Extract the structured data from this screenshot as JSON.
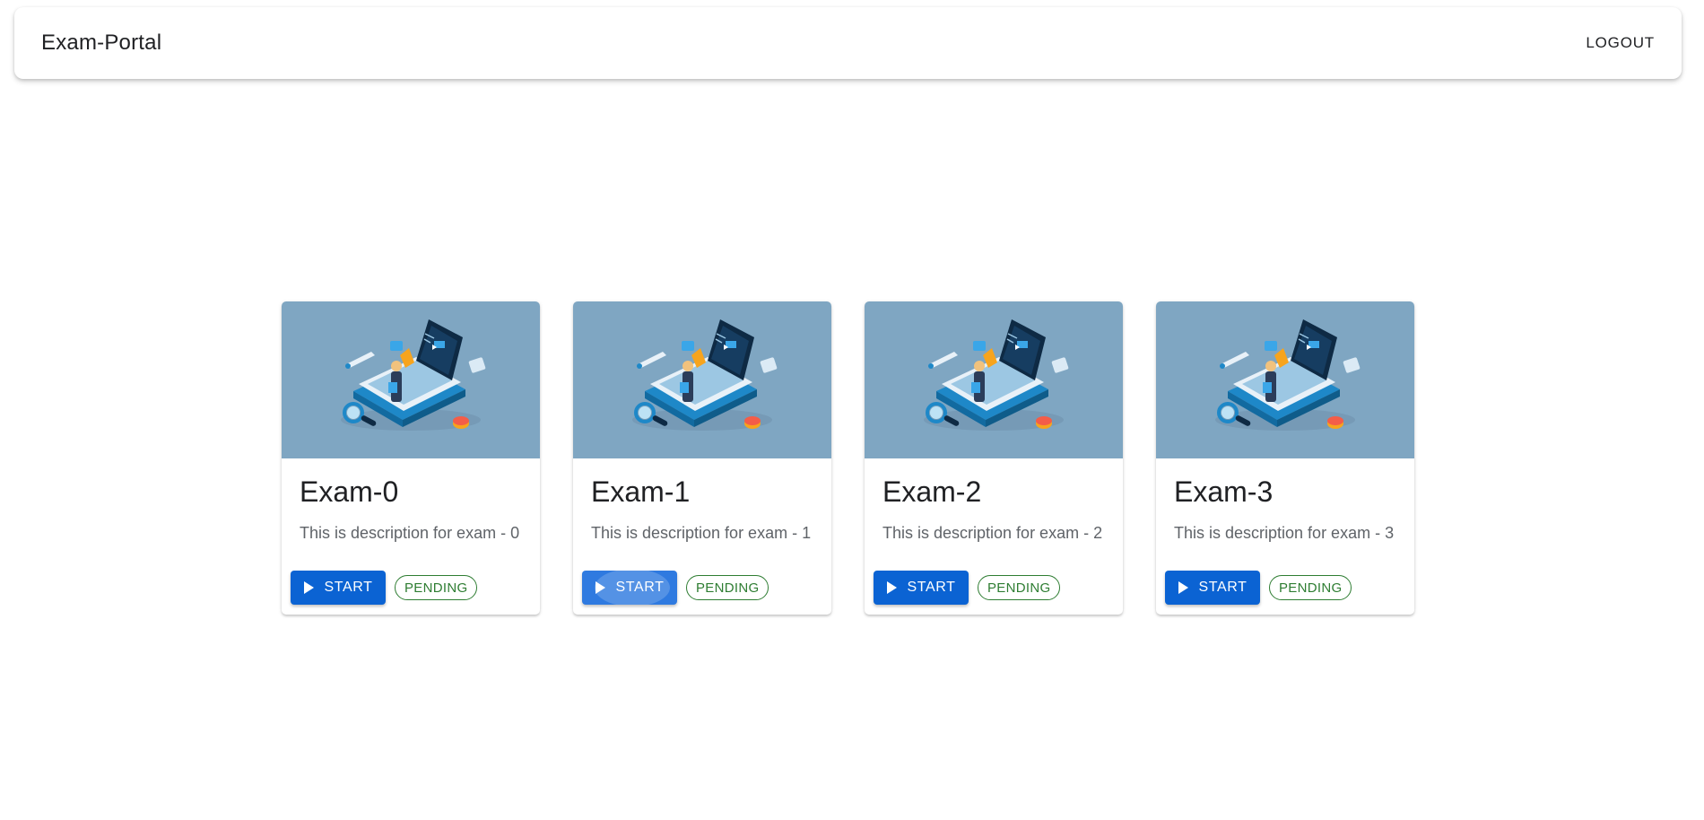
{
  "app": {
    "title": "Exam-Portal",
    "logout_label": "LOGOUT"
  },
  "exams": [
    {
      "title": "Exam-0",
      "description": "This is description for exam - 0",
      "start_label": "START",
      "status": "PENDING"
    },
    {
      "title": "Exam-1",
      "description": "This is description for exam - 1",
      "start_label": "START",
      "status": "PENDING"
    },
    {
      "title": "Exam-2",
      "description": "This is description for exam - 2",
      "start_label": "START",
      "status": "PENDING"
    },
    {
      "title": "Exam-3",
      "description": "This is description for exam - 3",
      "start_label": "START",
      "status": "PENDING"
    }
  ],
  "colors": {
    "primary": "#0b63d3",
    "success": "#2e7d32",
    "media_bg": "#7fa6c2"
  },
  "icons": {
    "start": "play-icon",
    "illustration": "laptop-study-illustration"
  }
}
